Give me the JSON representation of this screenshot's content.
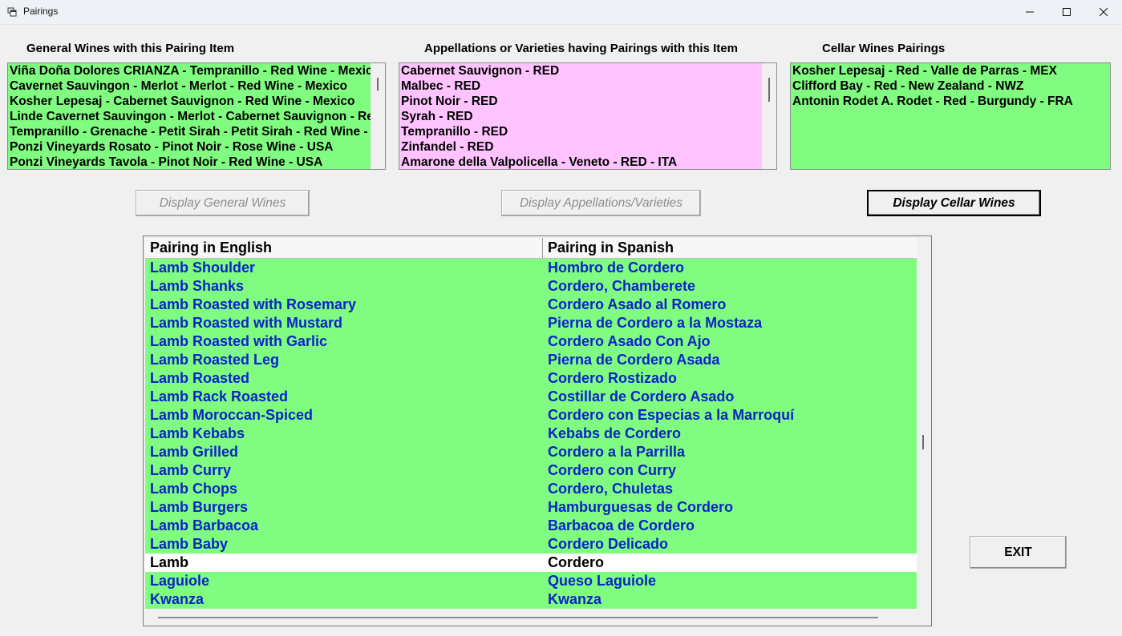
{
  "window": {
    "title": "Pairings"
  },
  "general_wines": {
    "heading": "General Wines  with this Pairing Item",
    "bg": "#80fc80",
    "items": [
      "Viña Doña Dolores  CRIANZA -  Tempranillo - Red Wine - Mexico",
      "Cavernet Sauvingon - Merlot -  Merlot - Red Wine - Mexico",
      "Kosher Lepesaj -  Cabernet Sauvignon - Red Wine - Mexico",
      "Linde Cavernet Sauvingon - Merlot -  Cabernet Sauvignon - Red Wine",
      "Tempranillo - Grenache - Petit Sirah -  Petit Sirah - Red Wine - Mexico",
      "Ponzi Vineyards Rosato -  Pinot Noir - Rose Wine - USA",
      "Ponzi Vineyards Tavola -  Pinot Noir - Red Wine - USA"
    ]
  },
  "appellations": {
    "heading": "Appellations or Varieties having Pairings  with this Item",
    "bg": "#ffc4ff",
    "items": [
      "Cabernet Sauvignon -  RED",
      "Malbec -  RED",
      "Pinot Noir -  RED",
      "Syrah -  RED",
      "Tempranillo -  RED",
      "Zinfandel -  RED",
      "Amarone della Valpolicella -  Veneto - RED - ITA"
    ]
  },
  "cellar_wines": {
    "heading": "Cellar Wines Pairings",
    "bg": "#80fc80",
    "items": [
      "Kosher Lepesaj - Red - Valle de Parras - MEX",
      "Clifford Bay - Red - New Zealand - NWZ",
      "Antonin Rodet A. Rodet - Red - Burgundy - FRA"
    ]
  },
  "buttons": {
    "display_general": "Display General Wines",
    "display_appellations": "Display Appellations/Varieties",
    "display_cellar": "Display Cellar Wines",
    "exit": "EXIT"
  },
  "grid": {
    "columns": [
      "Pairing in English",
      "Pairing in Spanish"
    ],
    "rows": [
      [
        "Lamb Shoulder",
        "Hombro de Cordero"
      ],
      [
        "Lamb Shanks",
        "Cordero, Chamberete"
      ],
      [
        "Lamb Roasted with Rosemary",
        "Cordero Asado al Romero"
      ],
      [
        "Lamb Roasted with Mustard",
        "Pierna de Cordero a la Mostaza"
      ],
      [
        "Lamb Roasted with Garlic",
        "Cordero Asado Con Ajo"
      ],
      [
        "Lamb Roasted Leg",
        "Pierna de Cordero Asada"
      ],
      [
        "Lamb Roasted",
        "Cordero Rostizado"
      ],
      [
        "Lamb Rack Roasted",
        "Costillar de Cordero Asado"
      ],
      [
        "Lamb Moroccan-Spiced",
        "Cordero con Especias a la Marroquí"
      ],
      [
        "Lamb Kebabs",
        "Kebabs de Cordero"
      ],
      [
        "Lamb Grilled",
        "Cordero a la Parrilla"
      ],
      [
        "Lamb Curry",
        "Cordero con Curry"
      ],
      [
        "Lamb Chops",
        "Cordero, Chuletas"
      ],
      [
        "Lamb Burgers",
        "Hamburguesas de Cordero"
      ],
      [
        "Lamb Barbacoa",
        "Barbacoa de Cordero"
      ],
      [
        "Lamb Baby",
        "Cordero Delicado"
      ],
      [
        "Lamb",
        "Cordero"
      ],
      [
        "Laguiole",
        "Queso Laguiole"
      ],
      [
        "Kwanza",
        "Kwanza"
      ]
    ],
    "selected_index": 16,
    "row_color": "#80fc80",
    "text_color": "#0a23c8"
  }
}
